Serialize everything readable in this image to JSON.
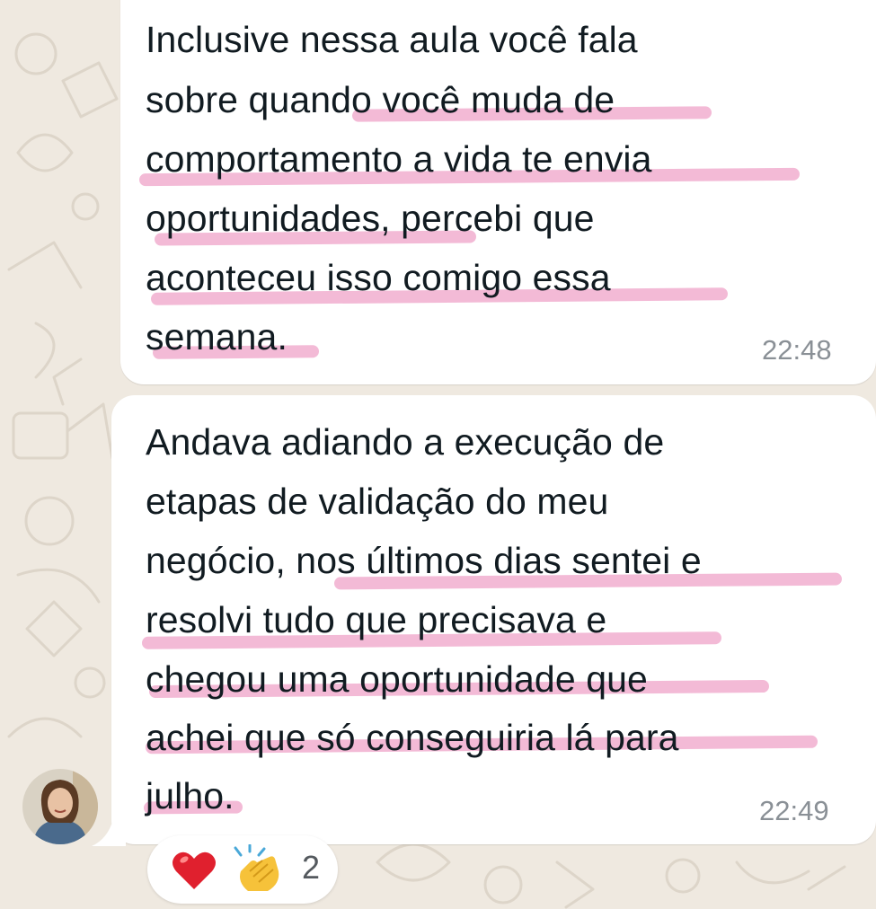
{
  "messages": [
    {
      "lines": [
        "Inclusive nessa aula você fala",
        "sobre quando você muda de",
        "comportamento a vida te envia",
        "oportunidades, percebi que",
        "aconteceu isso comigo essa",
        "semana."
      ],
      "time": "22:48"
    },
    {
      "lines": [
        "Andava adiando a execução de",
        "etapas de validação do meu",
        "negócio, nos últimos dias sentei e",
        "resolvi tudo que precisava e",
        "chegou uma oportunidade que",
        "achei que só conseguiria lá para",
        "julho."
      ],
      "time": "22:49"
    }
  ],
  "reactions": {
    "items": [
      "heart-emoji",
      "clapping-hands-emoji"
    ],
    "count": "2"
  },
  "colors": {
    "highlight": "#ee9fc6",
    "bubble": "#ffffff",
    "wallpaper": "#efe9e0",
    "text": "#111b21",
    "timestamp": "#8a9096"
  }
}
